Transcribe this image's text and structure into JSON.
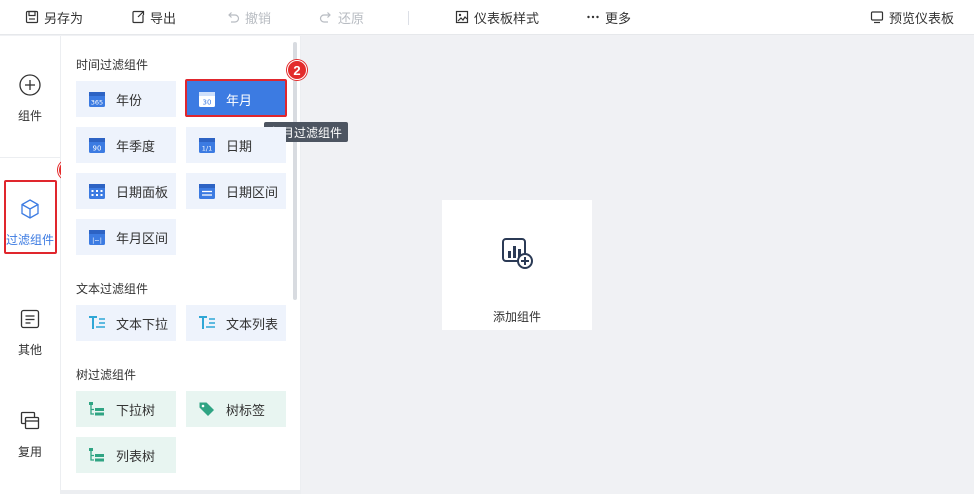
{
  "toolbar": {
    "save_as": "另存为",
    "export": "导出",
    "undo": "撤销",
    "redo": "还原",
    "dashboard_style": "仪表板样式",
    "more": "更多",
    "preview": "预览仪表板"
  },
  "rail": {
    "items": [
      {
        "label": "组件",
        "icon": "plus-circle-icon"
      },
      {
        "label": "过滤组件",
        "icon": "cube-icon",
        "active": true
      },
      {
        "label": "其他",
        "icon": "document-icon"
      },
      {
        "label": "复用",
        "icon": "copy-icon"
      }
    ]
  },
  "panel": {
    "sections": [
      {
        "title": "时间过滤组件",
        "items": [
          {
            "label": "年份",
            "icon": "calendar-365-icon"
          },
          {
            "label": "年月",
            "icon": "calendar-30-icon",
            "selected": true
          },
          {
            "label": "年季度",
            "icon": "calendar-90-icon"
          },
          {
            "label": "日期",
            "icon": "calendar-1-1-icon"
          },
          {
            "label": "日期面板",
            "icon": "calendar-grid-icon"
          },
          {
            "label": "日期区间",
            "icon": "calendar-range-icon"
          },
          {
            "label": "年月区间",
            "icon": "calendar-month-range-icon"
          }
        ]
      },
      {
        "title": "文本过滤组件",
        "items": [
          {
            "label": "文本下拉",
            "icon": "text-dropdown-icon"
          },
          {
            "label": "文本列表",
            "icon": "text-list-icon"
          }
        ]
      },
      {
        "title": "树过滤组件",
        "items": [
          {
            "label": "下拉树",
            "icon": "tree-dropdown-icon"
          },
          {
            "label": "树标签",
            "icon": "tag-icon"
          },
          {
            "label": "列表树",
            "icon": "tree-list-icon"
          }
        ]
      }
    ]
  },
  "tooltip": "年月过滤组件",
  "canvas": {
    "add_label": "添加组件"
  },
  "annotations": {
    "badge1": "1",
    "badge2": "2"
  },
  "colors": {
    "accent": "#3c7be2",
    "highlight": "#e0262d"
  }
}
